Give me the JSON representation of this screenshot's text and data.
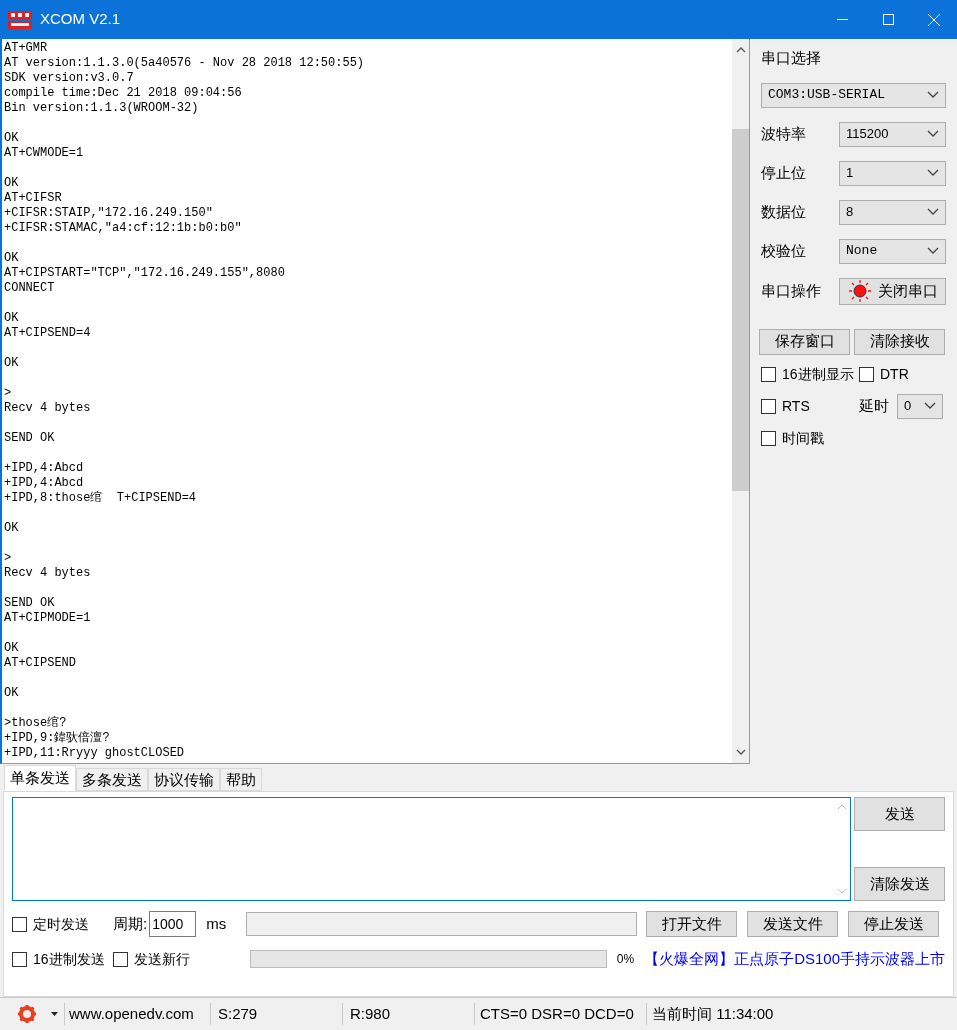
{
  "window": {
    "title": "XCOM V2.1"
  },
  "receive_log": [
    [
      "AT+GMR",
      "AT version:1.1.3.0(5a40576 - Nov 28 2018 12:50:55)",
      "SDK version:v3.0.7",
      "compile time:Dec 21 2018 09:04:56",
      "Bin version:1.1.3(WROOM-32)"
    ],
    [
      "OK",
      "AT+CWMODE=1"
    ],
    [
      "OK",
      "AT+CIFSR",
      "+CIFSR:STAIP,\"172.16.249.150\"",
      "+CIFSR:STAMAC,\"a4:cf:12:1b:b0:b0\""
    ],
    [
      "OK",
      "AT+CIPSTART=\"TCP\",\"172.16.249.155\",8080",
      "CONNECT"
    ],
    [
      "OK",
      "AT+CIPSEND=4"
    ],
    [
      "OK"
    ],
    [
      ">",
      "Recv 4 bytes"
    ],
    [
      "SEND OK"
    ],
    [
      "+IPD,4:Abcd",
      "+IPD,4:Abcd",
      "+IPD,8:those绾  T+CIPSEND=4"
    ],
    [
      "OK"
    ],
    [
      ">",
      "Recv 4 bytes"
    ],
    [
      "SEND OK",
      "AT+CIPMODE=1"
    ],
    [
      "OK",
      "AT+CIPSEND"
    ],
    [
      "OK"
    ],
    [
      ">those绾?",
      "+IPD,9:鍏驮倍澶?",
      "+IPD,11:Rryyy ghostCLOSED"
    ]
  ],
  "port_select": {
    "label": "串口选择",
    "value": "COM3:USB-SERIAL"
  },
  "settings": [
    {
      "label": "波特率",
      "value": "115200"
    },
    {
      "label": "停止位",
      "value": "1"
    },
    {
      "label": "数据位",
      "value": "8"
    },
    {
      "label": "校验位",
      "value": "None"
    }
  ],
  "port_operation": {
    "label": "串口操作",
    "button": "关闭串口",
    "open": true
  },
  "panel_buttons": [
    "保存窗口",
    "清除接收"
  ],
  "options": [
    {
      "label": "16进制显示",
      "checked": false
    },
    {
      "label": "DTR",
      "checked": false
    },
    {
      "label": "RTS",
      "checked": false
    },
    {
      "label": "时间戳",
      "checked": false
    }
  ],
  "delay": {
    "label": "延时",
    "value": "0"
  },
  "tabs": [
    {
      "label": "单条发送",
      "selected": true
    },
    {
      "label": "多条发送",
      "selected": false
    },
    {
      "label": "协议传输",
      "selected": false
    },
    {
      "label": "帮助",
      "selected": false
    }
  ],
  "send_buttons": [
    "发送",
    "清除发送"
  ],
  "timed_send": {
    "label": "定时发送",
    "checked": false
  },
  "period": {
    "label": "周期:",
    "value": "1000",
    "unit": "ms"
  },
  "file_buttons": [
    "打开文件",
    "发送文件",
    "停止发送"
  ],
  "send_options": [
    {
      "label": "16进制发送",
      "checked": false
    },
    {
      "label": "发送新行",
      "checked": false
    }
  ],
  "progress": {
    "level": 0,
    "reading": "0%"
  },
  "ad_link": "【火爆全网】正点原子DS100手持示波器上市",
  "status_bar": {
    "website": "www.openedv.com",
    "sent": "S:279",
    "received": "R:980",
    "signals": "CTS=0 DSR=0 DCD=0",
    "time": "当前时间 11:34:00"
  }
}
